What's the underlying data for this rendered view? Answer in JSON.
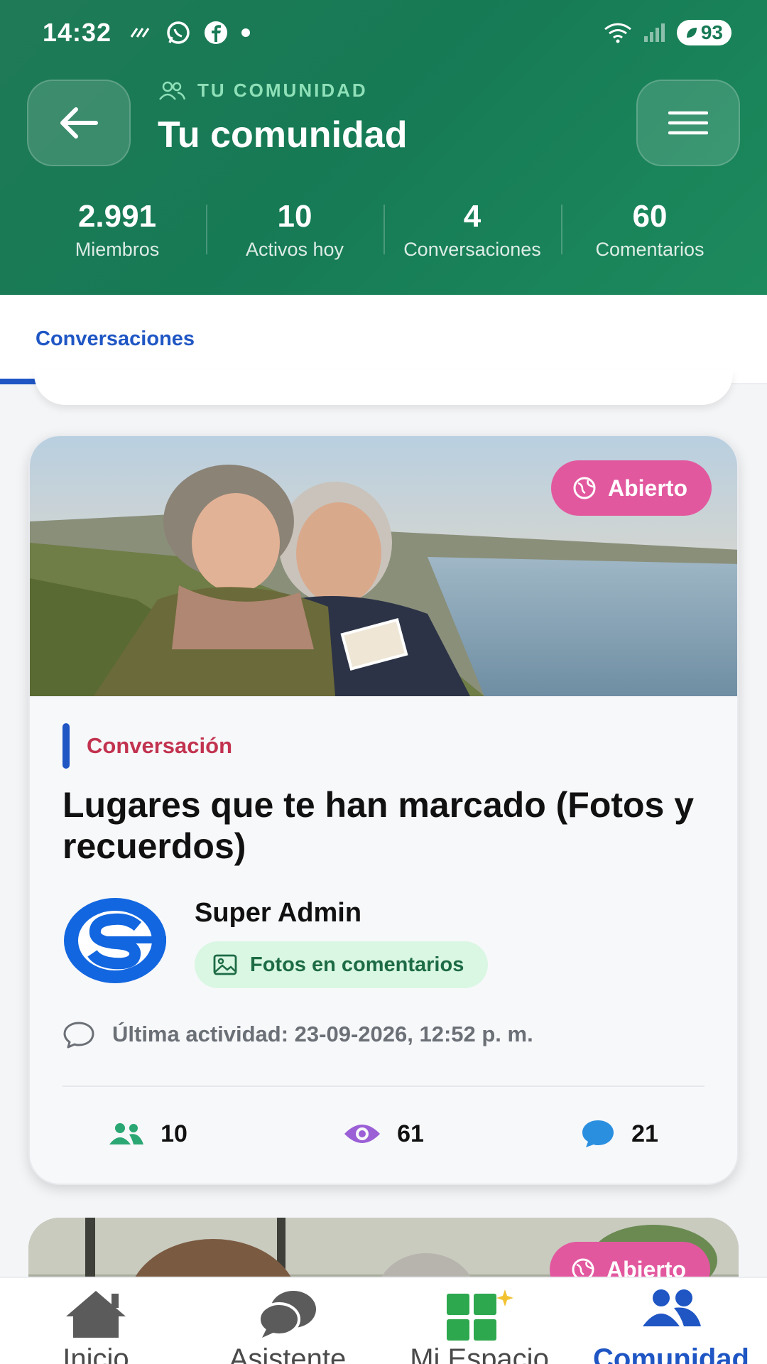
{
  "status_bar": {
    "time": "14:32",
    "battery": "93"
  },
  "header": {
    "eyebrow": "TU COMUNIDAD",
    "title": "Tu comunidad",
    "stats": [
      {
        "value": "2.991",
        "label": "Miembros"
      },
      {
        "value": "10",
        "label": "Activos hoy"
      },
      {
        "value": "4",
        "label": "Conversaciones"
      },
      {
        "value": "60",
        "label": "Comentarios"
      }
    ]
  },
  "tabs": [
    {
      "label": "Conversaciones",
      "active": true
    }
  ],
  "card": {
    "badge": "Abierto",
    "type": "Conversación",
    "title": "Lugares que te han marcado (Fotos y recuerdos)",
    "author": "Super Admin",
    "chip": "Fotos en comentarios",
    "activity": "Última actividad: 23-09-2026, 12:52 p. m.",
    "metrics": {
      "participants": "10",
      "views": "61",
      "comments": "21"
    }
  },
  "next_card": {
    "badge": "Abierto"
  },
  "bottom_nav": [
    {
      "label": "Inicio",
      "icon": "home-icon"
    },
    {
      "label": "Asistente",
      "icon": "chat-bubbles-icon"
    },
    {
      "label": "Mi Espacio",
      "icon": "grid-sparkle-icon"
    },
    {
      "label": "Comunidad",
      "icon": "people-icon",
      "active": true
    }
  ],
  "colors": {
    "header_green": "#167a55",
    "accent_blue": "#1f56c4",
    "badge_pink": "#e2589f",
    "type_red": "#c2334f"
  }
}
